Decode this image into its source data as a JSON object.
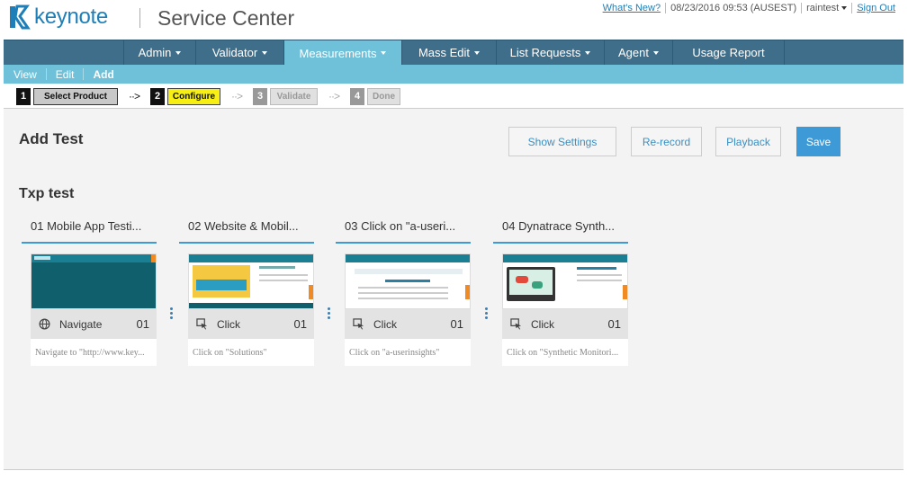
{
  "header": {
    "logo_text": "keynote",
    "app_title": "Service Center",
    "whats_new": "What's New?",
    "datetime": "08/23/2016 09:53 (AUSEST)",
    "user": "raintest",
    "sign_out": "Sign Out"
  },
  "nav": {
    "items": [
      {
        "label": "Admin"
      },
      {
        "label": "Validator"
      },
      {
        "label": "Measurements"
      },
      {
        "label": "Mass Edit"
      },
      {
        "label": "List Requests"
      },
      {
        "label": "Agent"
      },
      {
        "label": "Usage Report"
      }
    ],
    "active": "Measurements"
  },
  "subnav": {
    "items": [
      "View",
      "Edit",
      "Add"
    ],
    "active": "Add"
  },
  "wizard": {
    "steps": [
      {
        "num": "1",
        "label": "Select Product"
      },
      {
        "num": "2",
        "label": "Configure"
      },
      {
        "num": "3",
        "label": "Validate"
      },
      {
        "num": "4",
        "label": "Done"
      }
    ],
    "current": "Configure"
  },
  "page": {
    "title": "Add Test",
    "buttons": {
      "show_settings": "Show Settings",
      "rerecord": "Re-record",
      "playback": "Playback",
      "save": "Save"
    },
    "section_title": "Txp test"
  },
  "test_steps": [
    {
      "title": "01 Mobile App Testi...",
      "action": "Navigate",
      "action_icon": "globe-icon",
      "count": "01",
      "description": "Navigate to \"http://www.key..."
    },
    {
      "title": "02 Website & Mobil...",
      "action": "Click",
      "action_icon": "click-icon",
      "count": "01",
      "description": "Click on \"Solutions\""
    },
    {
      "title": "03 Click on \"a-useri...",
      "action": "Click",
      "action_icon": "click-icon",
      "count": "01",
      "description": "Click on \"a-userinsights\""
    },
    {
      "title": "04 Dynatrace Synth...",
      "action": "Click",
      "action_icon": "click-icon",
      "count": "01",
      "description": "Click on \"Synthetic Monitori..."
    }
  ],
  "colors": {
    "brand_blue": "#1e7fb8",
    "nav_bg": "#3f6e8a",
    "subnav_bg": "#6fc1d9",
    "accent": "#3d9ad6",
    "step_current": "#f7ef14"
  }
}
